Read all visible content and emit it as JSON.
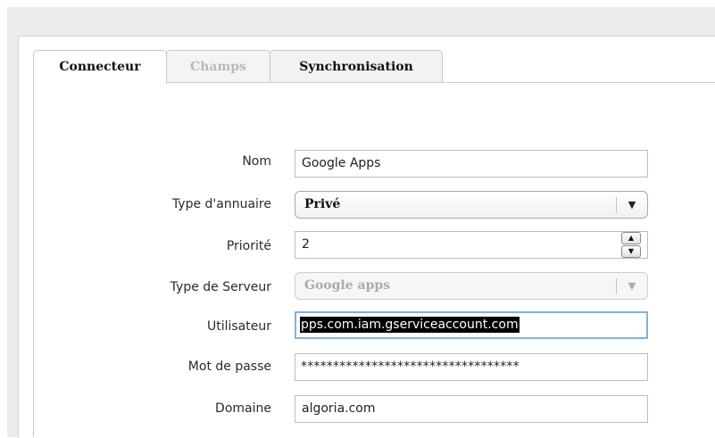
{
  "tabs": [
    {
      "label": "Connecteur",
      "state": "active"
    },
    {
      "label": "Champs",
      "state": "disabled"
    },
    {
      "label": "Synchronisation",
      "state": "normal"
    }
  ],
  "form": {
    "nom": {
      "label": "Nom",
      "value": "Google Apps"
    },
    "type_annuaire": {
      "label": "Type d'annuaire",
      "value": "Privé"
    },
    "priorite": {
      "label": "Priorité",
      "value": "2"
    },
    "type_serveur": {
      "label": "Type de Serveur",
      "value": "Google apps"
    },
    "utilisateur": {
      "label": "Utilisateur",
      "value": "pps.com.iam.gserviceaccount.com"
    },
    "mot_de_passe": {
      "label": "Mot de passe",
      "value": "**********************************"
    },
    "domaine": {
      "label": "Domaine",
      "value": "algoria.com"
    }
  },
  "icons": {
    "dropdown_arrow": "▼",
    "spin_up": "▲",
    "spin_down": "▼"
  },
  "colors": {
    "focus_border": "#7fb3de",
    "disabled_text": "#aaaaaa"
  }
}
